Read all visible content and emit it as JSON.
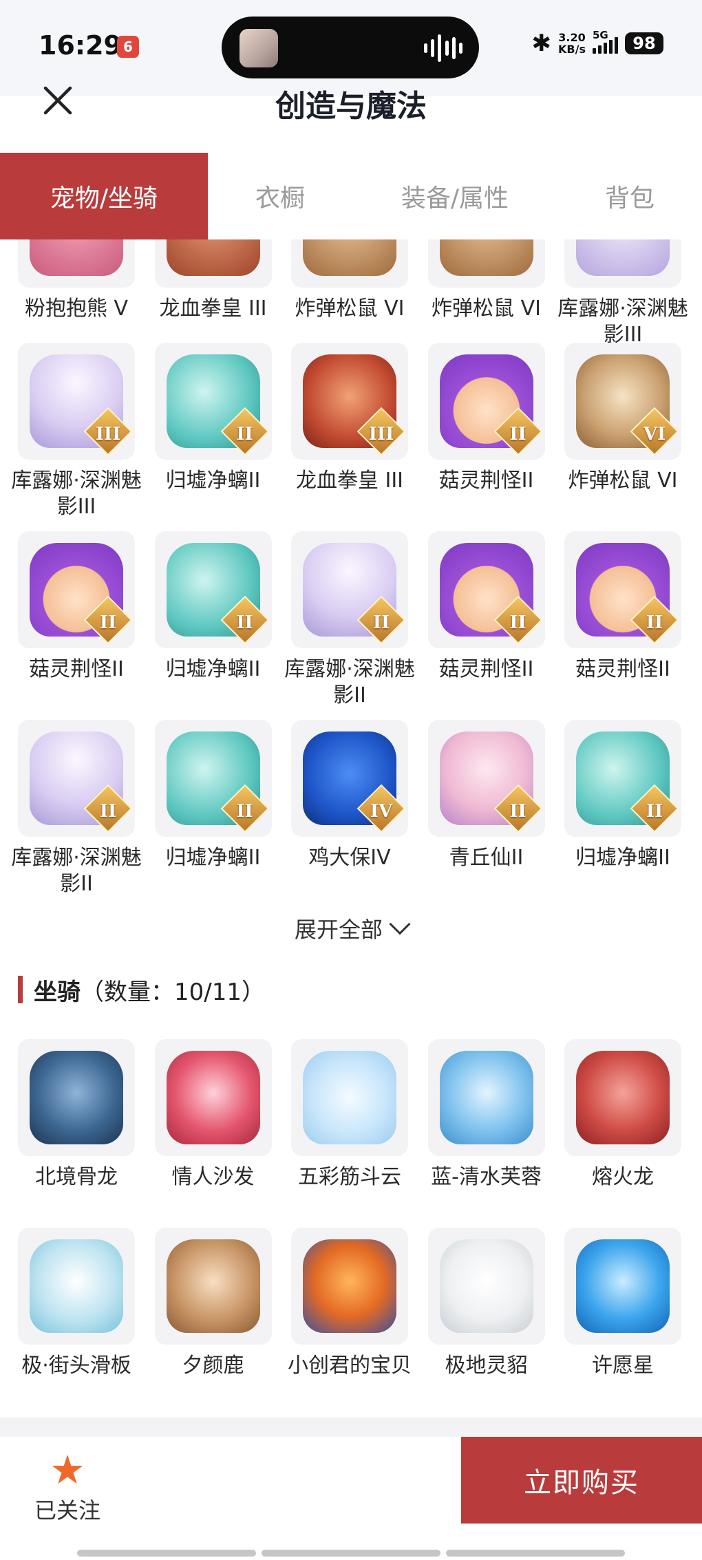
{
  "status_bar": {
    "time": "16:29",
    "app_badge": "6",
    "network_speed_value": "3.20",
    "network_speed_unit": "KB/s",
    "network_type": "5G",
    "battery": "98"
  },
  "header": {
    "title": "创造与魔法"
  },
  "tabs": [
    {
      "label": "宠物/坐骑",
      "active": true
    },
    {
      "label": "衣橱",
      "active": false
    },
    {
      "label": "装备/属性",
      "active": false
    },
    {
      "label": "背包",
      "active": false
    }
  ],
  "pets": {
    "partial_row": [
      {
        "name": "粉抱抱熊 V",
        "rank": "V"
      },
      {
        "name": "龙血拳皇 III",
        "rank": "III"
      },
      {
        "name": "炸弹松鼠 VI",
        "rank": "VI"
      },
      {
        "name": "炸弹松鼠 VI",
        "rank": "VI"
      },
      {
        "name": "库露娜·深渊魅影III",
        "rank": "III"
      }
    ],
    "rows": [
      [
        {
          "name": "库露娜·深渊魅影III",
          "rank": "III"
        },
        {
          "name": "归墟净螭II",
          "rank": "II"
        },
        {
          "name": "龙血拳皇 III",
          "rank": "III"
        },
        {
          "name": "菇灵荆怪II",
          "rank": "II"
        },
        {
          "name": "炸弹松鼠 VI",
          "rank": "VI"
        }
      ],
      [
        {
          "name": "菇灵荆怪II",
          "rank": "II"
        },
        {
          "name": "归墟净螭II",
          "rank": "II"
        },
        {
          "name": "库露娜·深渊魅影II",
          "rank": "II"
        },
        {
          "name": "菇灵荆怪II",
          "rank": "II"
        },
        {
          "name": "菇灵荆怪II",
          "rank": "II"
        }
      ],
      [
        {
          "name": "库露娜·深渊魅影II",
          "rank": "II"
        },
        {
          "name": "归墟净螭II",
          "rank": "II"
        },
        {
          "name": "鸡大保IV",
          "rank": "IV"
        },
        {
          "name": "青丘仙II",
          "rank": "II"
        },
        {
          "name": "归墟净螭II",
          "rank": "II"
        }
      ]
    ],
    "expand_label": "展开全部"
  },
  "mounts": {
    "title": "坐骑",
    "count_text": "（数量：10/11）",
    "items": [
      {
        "name": "北境骨龙"
      },
      {
        "name": "情人沙发"
      },
      {
        "name": "五彩筋斗云"
      },
      {
        "name": "蓝-清水芙蓉"
      },
      {
        "name": "熔火龙"
      },
      {
        "name": "极·街头滑板"
      },
      {
        "name": "夕颜鹿"
      },
      {
        "name": "小创君的宝贝"
      },
      {
        "name": "极地灵貂"
      },
      {
        "name": "许愿星"
      }
    ]
  },
  "bottom_bar": {
    "follow_label": "已关注",
    "buy_label": "立即购买"
  },
  "colors": {
    "accent": "#b93b3b",
    "star": "#f0682a"
  }
}
